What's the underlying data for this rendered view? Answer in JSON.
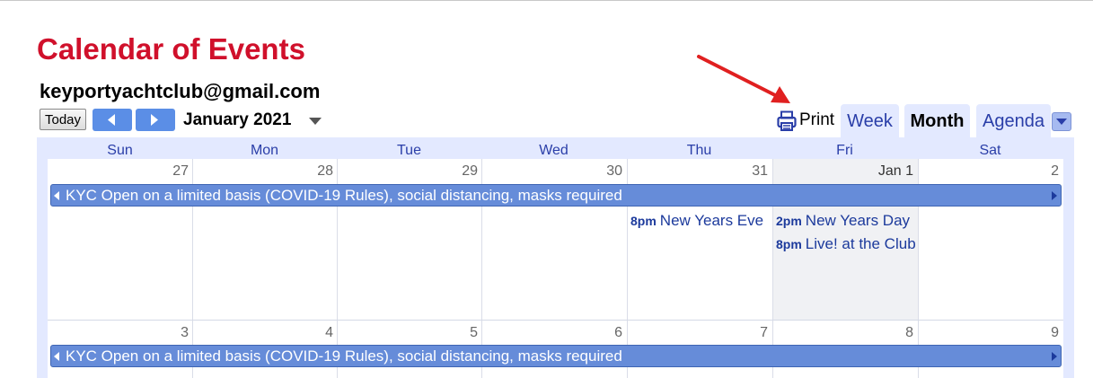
{
  "title": "Calendar of Events",
  "calendar_owner": "keyportyachtclub@gmail.com",
  "toolbar": {
    "today_label": "Today",
    "month_label": "January 2021",
    "print_label": "Print"
  },
  "tabs": [
    {
      "label": "Week",
      "active": false
    },
    {
      "label": "Month",
      "active": true
    },
    {
      "label": "Agenda",
      "active": false
    }
  ],
  "days_of_week": [
    "Sun",
    "Mon",
    "Tue",
    "Wed",
    "Thu",
    "Fri",
    "Sat"
  ],
  "weeks": [
    {
      "days": [
        "27",
        "28",
        "29",
        "30",
        "31",
        "Jan 1",
        "2"
      ],
      "allday_event": "KYC Open on a limited basis (COVID-19 Rules), social distancing, masks required",
      "events": [
        {
          "day": "Thu",
          "time": "8pm",
          "title": "New Years Eve"
        },
        {
          "day": "Fri",
          "time": "2pm",
          "title": "New Years Day"
        },
        {
          "day": "Fri",
          "time": "8pm",
          "title": "Live! at the Club"
        }
      ]
    },
    {
      "days": [
        "3",
        "4",
        "5",
        "6",
        "7",
        "8",
        "9"
      ],
      "allday_event": "KYC Open on a limited basis (COVID-19 Rules), social distancing, masks required",
      "events": []
    }
  ],
  "colors": {
    "title": "#d0102b",
    "nav_button": "#5b8ee6",
    "frame": "#e3e9ff",
    "allday_event": "#668cd9",
    "event_text": "#1c3a9c",
    "annotation_arrow": "#e02020"
  }
}
